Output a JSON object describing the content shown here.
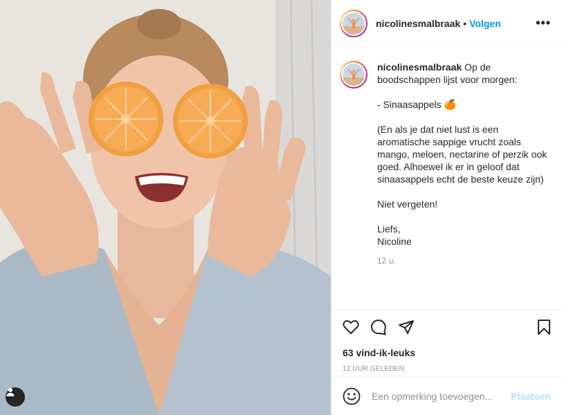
{
  "post": {
    "username": "nicolinesmalbraak",
    "follow_label": "Volgen",
    "more_label": "•••",
    "dot": "•"
  },
  "caption": {
    "username": "nicolinesmalbraak",
    "text": " Op de boodschappen lijst voor morgen:\n\n- Sinaasappels 🍊\n\n(En als je dat niet lust is een aromatische sappige vrucht zoals mango, meloen, nectarine of perzik ook goed. Alhoewel ik er in geloof dat sinaasappels echt de beste keuze zijn)\n\nNiet vergeten!\n\nLiefs,\nNicoline",
    "time": "12 u."
  },
  "actions": {
    "icons": [
      "heart-icon",
      "comment-icon",
      "share-icon",
      "bookmark-icon"
    ],
    "likes": "63 vind-ik-leuks",
    "posted": "12 UUR GELEDEN"
  },
  "comment_box": {
    "placeholder": "Een opmerking toevoegen...",
    "post_label": "Plaatsen"
  },
  "colors": {
    "link_blue": "#0095f6",
    "post_disabled": "#b2dffc",
    "secondary_text": "#8e8e8e",
    "orange": "#f59a3c"
  }
}
